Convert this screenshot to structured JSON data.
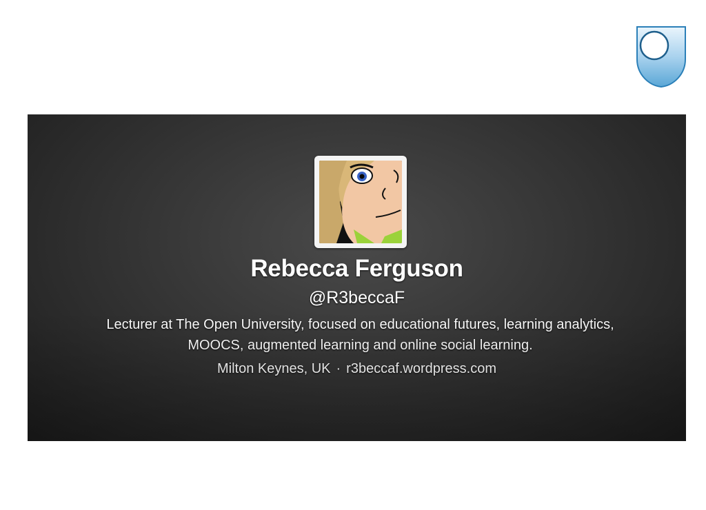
{
  "logo": {
    "icon": "open-university-shield-icon",
    "colors": {
      "shield_light": "#cfe6f5",
      "shield_dark": "#5aa7d6",
      "outline": "#2a7fb8"
    }
  },
  "profile": {
    "display_name": "Rebecca Ferguson",
    "handle": "@R3beccaF",
    "bio": "Lecturer at The Open University, focused on educational futures, learning analytics, MOOCS, augmented learning and online social learning.",
    "location": "Milton Keynes, UK",
    "separator": "·",
    "website": "r3beccaf.wordpress.com",
    "avatar_icon": "cartoon-avatar-icon"
  },
  "colors": {
    "page_background": "#ffffff",
    "card_background": "#333333",
    "text": "#ffffff"
  }
}
